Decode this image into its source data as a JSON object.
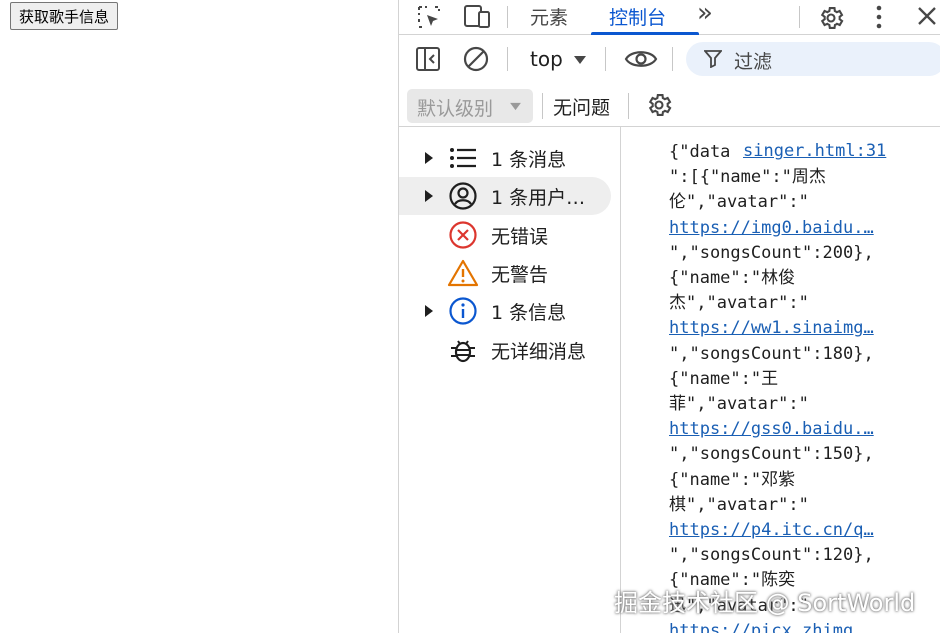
{
  "page": {
    "button_label": "获取歌手信息"
  },
  "devtools": {
    "tabs": {
      "elements": "元素",
      "console": "控制台",
      "more": "»"
    },
    "toolbar": {
      "context": "top",
      "filter_placeholder": "过滤",
      "level": "默认级别",
      "issues": "无问题"
    },
    "sidebar": {
      "items": [
        {
          "label": "1 条消息",
          "icon": "list-icon"
        },
        {
          "label": "1 条用户…",
          "icon": "user-circle-icon"
        },
        {
          "label": "无错误",
          "icon": "error-icon"
        },
        {
          "label": "无警告",
          "icon": "warning-icon"
        },
        {
          "label": "1 条信息",
          "icon": "info-icon"
        },
        {
          "label": "无详细消息",
          "icon": "bug-icon"
        }
      ]
    },
    "console": {
      "source": "singer.html:31",
      "lines": [
        {
          "text": "{\"data",
          "link": false
        },
        {
          "text": "\":[{\"name\":\"周杰",
          "link": false
        },
        {
          "text": "伦\",\"avatar\":\"",
          "link": false
        },
        {
          "text": "https://img0.baidu.…",
          "link": true
        },
        {
          "text": "\",\"songsCount\":200},",
          "link": false
        },
        {
          "text": "{\"name\":\"林俊",
          "link": false
        },
        {
          "text": "杰\",\"avatar\":\"",
          "link": false
        },
        {
          "text": "https://ww1.sinaimg…",
          "link": true
        },
        {
          "text": "\",\"songsCount\":180},",
          "link": false
        },
        {
          "text": "{\"name\":\"王",
          "link": false
        },
        {
          "text": "菲\",\"avatar\":\"",
          "link": false
        },
        {
          "text": "https://gss0.baidu.…",
          "link": true
        },
        {
          "text": "\",\"songsCount\":150},",
          "link": false
        },
        {
          "text": "{\"name\":\"邓紫",
          "link": false
        },
        {
          "text": "棋\",\"avatar\":\"",
          "link": false
        },
        {
          "text": "https://p4.itc.cn/q…",
          "link": true
        },
        {
          "text": "\",\"songsCount\":120},",
          "link": false
        },
        {
          "text": "{\"name\":\"陈奕",
          "link": false
        },
        {
          "text": "迅\",\"avatar\":\"",
          "link": false
        },
        {
          "text": "https://picx.zhimg.…",
          "link": true
        }
      ]
    }
  },
  "watermark": "掘金技术社区 @ SortWorld",
  "colors": {
    "accent": "#0b57d0",
    "link": "#1a5fb4",
    "error": "#dc362e",
    "warning": "#e37400",
    "info": "#0b57d0"
  }
}
